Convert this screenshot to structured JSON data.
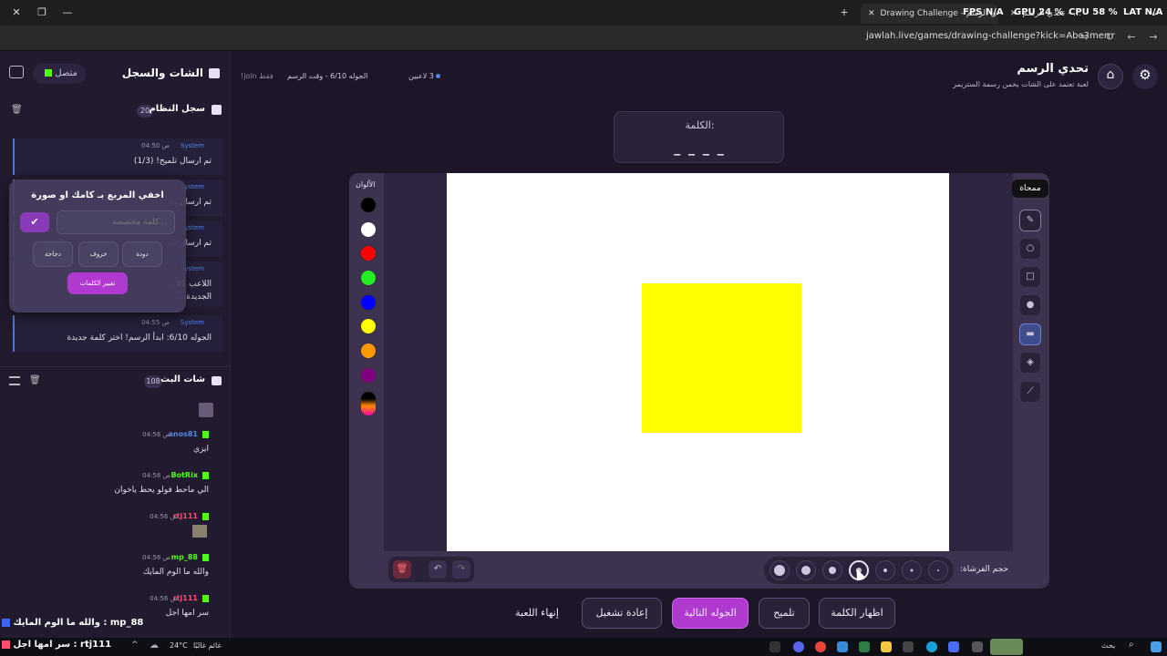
{
  "browser": {
    "tab1_title": "Drawing Challenge - تحدي الرسم",
    "tab2_title": "تحدي الرسم - ...",
    "hud_fps": "FPS N/A",
    "hud_gpu": "GPU 24 %",
    "hud_cpu": "CPU 58 %",
    "hud_lat": "LAT N/A",
    "url": "jawlah.live/games/drawing-challenge?kick=Abo3merrr"
  },
  "sidebar": {
    "title": "الشات والسجل",
    "status": "متصل",
    "system_log_title": "سجل النظام",
    "system_log_count": "20",
    "system_messages": [
      {
        "name": "System",
        "time": "04:50 ص",
        "text": "تم ارسال تلميح! (1/3)"
      },
      {
        "name": "System",
        "time": "",
        "text": "تم ارسال ..."
      },
      {
        "name": "System",
        "time": "",
        "text": "تم ارسال ..."
      },
      {
        "name": "System",
        "time": "",
        "text": "اللاعب 31 ..."
      },
      {
        "name": "System",
        "time": "04:55 ص",
        "text": "الجوله 6/10: ابدأ الرسم! اختر كلمة جديدة"
      }
    ],
    "system_msg4_line2": "الجديدة: ..",
    "chat_title": "شات البث",
    "chat_count": "108",
    "chat_messages": [
      {
        "name": "anos81",
        "time": "04:56 ص",
        "text": "ايزي",
        "color": "#4f86e8"
      },
      {
        "name": "BotRix",
        "time": "04:56 ص",
        "text": "الي ماحط فولو يحط ياخوان",
        "color": "#53fc18"
      },
      {
        "name": "rtj111",
        "time": "04:56 ص",
        "text": "",
        "color": "#ff4d6d"
      },
      {
        "name": "mp_88",
        "time": "04:56 ص",
        "text": "والله ما الوم المايك",
        "color": "#53fc18"
      },
      {
        "name": "rtj111",
        "time": "04:56 ص",
        "text": "سر امها اجل",
        "color": "#ff4d6d"
      }
    ]
  },
  "popup": {
    "title": "اخفي المربع بـ كامك او صورة",
    "placeholder": "كلمة مخصصة...",
    "words": [
      "دودة",
      "خروف",
      "دجاجة"
    ],
    "change_words": "تغيير الكلمات"
  },
  "game": {
    "title": "تحدي الرسم",
    "subtitle": "لعبة تعتمد على الشات يخمن رسمة الستريمر",
    "players": "3 لاعبين",
    "round_info": "الجوله 6/10 - وقت الرسم",
    "join_only": "!join فقط",
    "word_label": "الكلمة:",
    "word_mask": "_ _ _ _",
    "colors_label": "الألوان",
    "brush_size_label": "حجم الفرشاة:",
    "eraser_tooltip": "ممحاة",
    "colors": [
      "#000000",
      "#ffffff",
      "#ff0000",
      "#22ee22",
      "#0000ff",
      "#ffff00",
      "#ff9900",
      "#800080"
    ],
    "canvas_shape_color": "#ffff00"
  },
  "actions": {
    "show_word": "اظهار الكلمة",
    "hint": "تلميح",
    "next_round": "الجوله التالية",
    "restart": "إعادة تشغيل",
    "end_game": "إنهاء اللعبة"
  },
  "overlay": {
    "line1": "والله ما الوم المايك : mp_88",
    "line2": "سر امها اجل : rtj111"
  },
  "taskbar": {
    "weather_temp": "24°C",
    "weather_text": "غائم غالبًا",
    "search": "بحث"
  }
}
